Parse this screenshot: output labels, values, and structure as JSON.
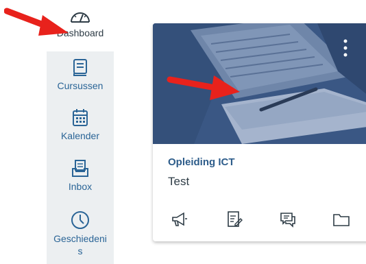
{
  "sidebar": {
    "items": [
      {
        "label": "Dashboard",
        "icon": "dashboard-icon",
        "active": true
      },
      {
        "label": "Cursussen",
        "icon": "book-icon",
        "active": false
      },
      {
        "label": "Kalender",
        "icon": "calendar-icon",
        "active": false
      },
      {
        "label": "Inbox",
        "icon": "inbox-icon",
        "active": false
      },
      {
        "label": "Geschiedeni\ns",
        "icon": "clock-icon",
        "active": false
      }
    ]
  },
  "card": {
    "title": "Opleiding ICT",
    "subtitle": "Test",
    "hero_color": "#3d5a86",
    "actions": [
      {
        "icon": "announcement-icon"
      },
      {
        "icon": "assignment-icon"
      },
      {
        "icon": "discussion-icon"
      },
      {
        "icon": "folder-icon"
      }
    ],
    "menu_icon": "more-vertical-icon"
  },
  "annotations": {
    "arrow_color": "#e8221c"
  },
  "colors": {
    "sidebar_bg": "#eceff1",
    "link_blue": "#2a6496",
    "text_dark": "#2d3b45"
  }
}
